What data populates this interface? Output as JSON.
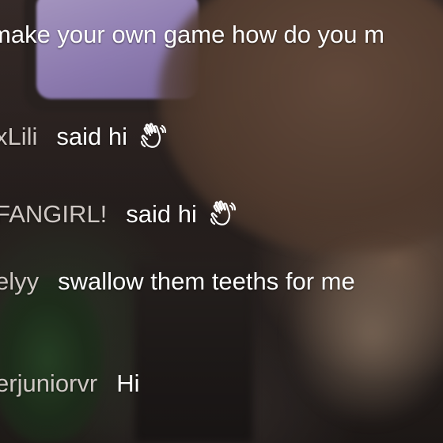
{
  "chat": {
    "messages": [
      {
        "username": "",
        "text": "make your own game how do you m",
        "icon": ""
      },
      {
        "username": "xLili",
        "text": "said hi",
        "icon": "waving-hand-icon"
      },
      {
        "username": "FANGIRL!",
        "text": "said hi",
        "icon": "waving-hand-icon"
      },
      {
        "username": "elyy",
        "text": "swallow them teeths for me",
        "icon": ""
      },
      {
        "username": "erjuniorvr",
        "text": "Hi",
        "icon": ""
      }
    ]
  },
  "colors": {
    "username": "#cfc8c4",
    "message": "#ffffff"
  }
}
